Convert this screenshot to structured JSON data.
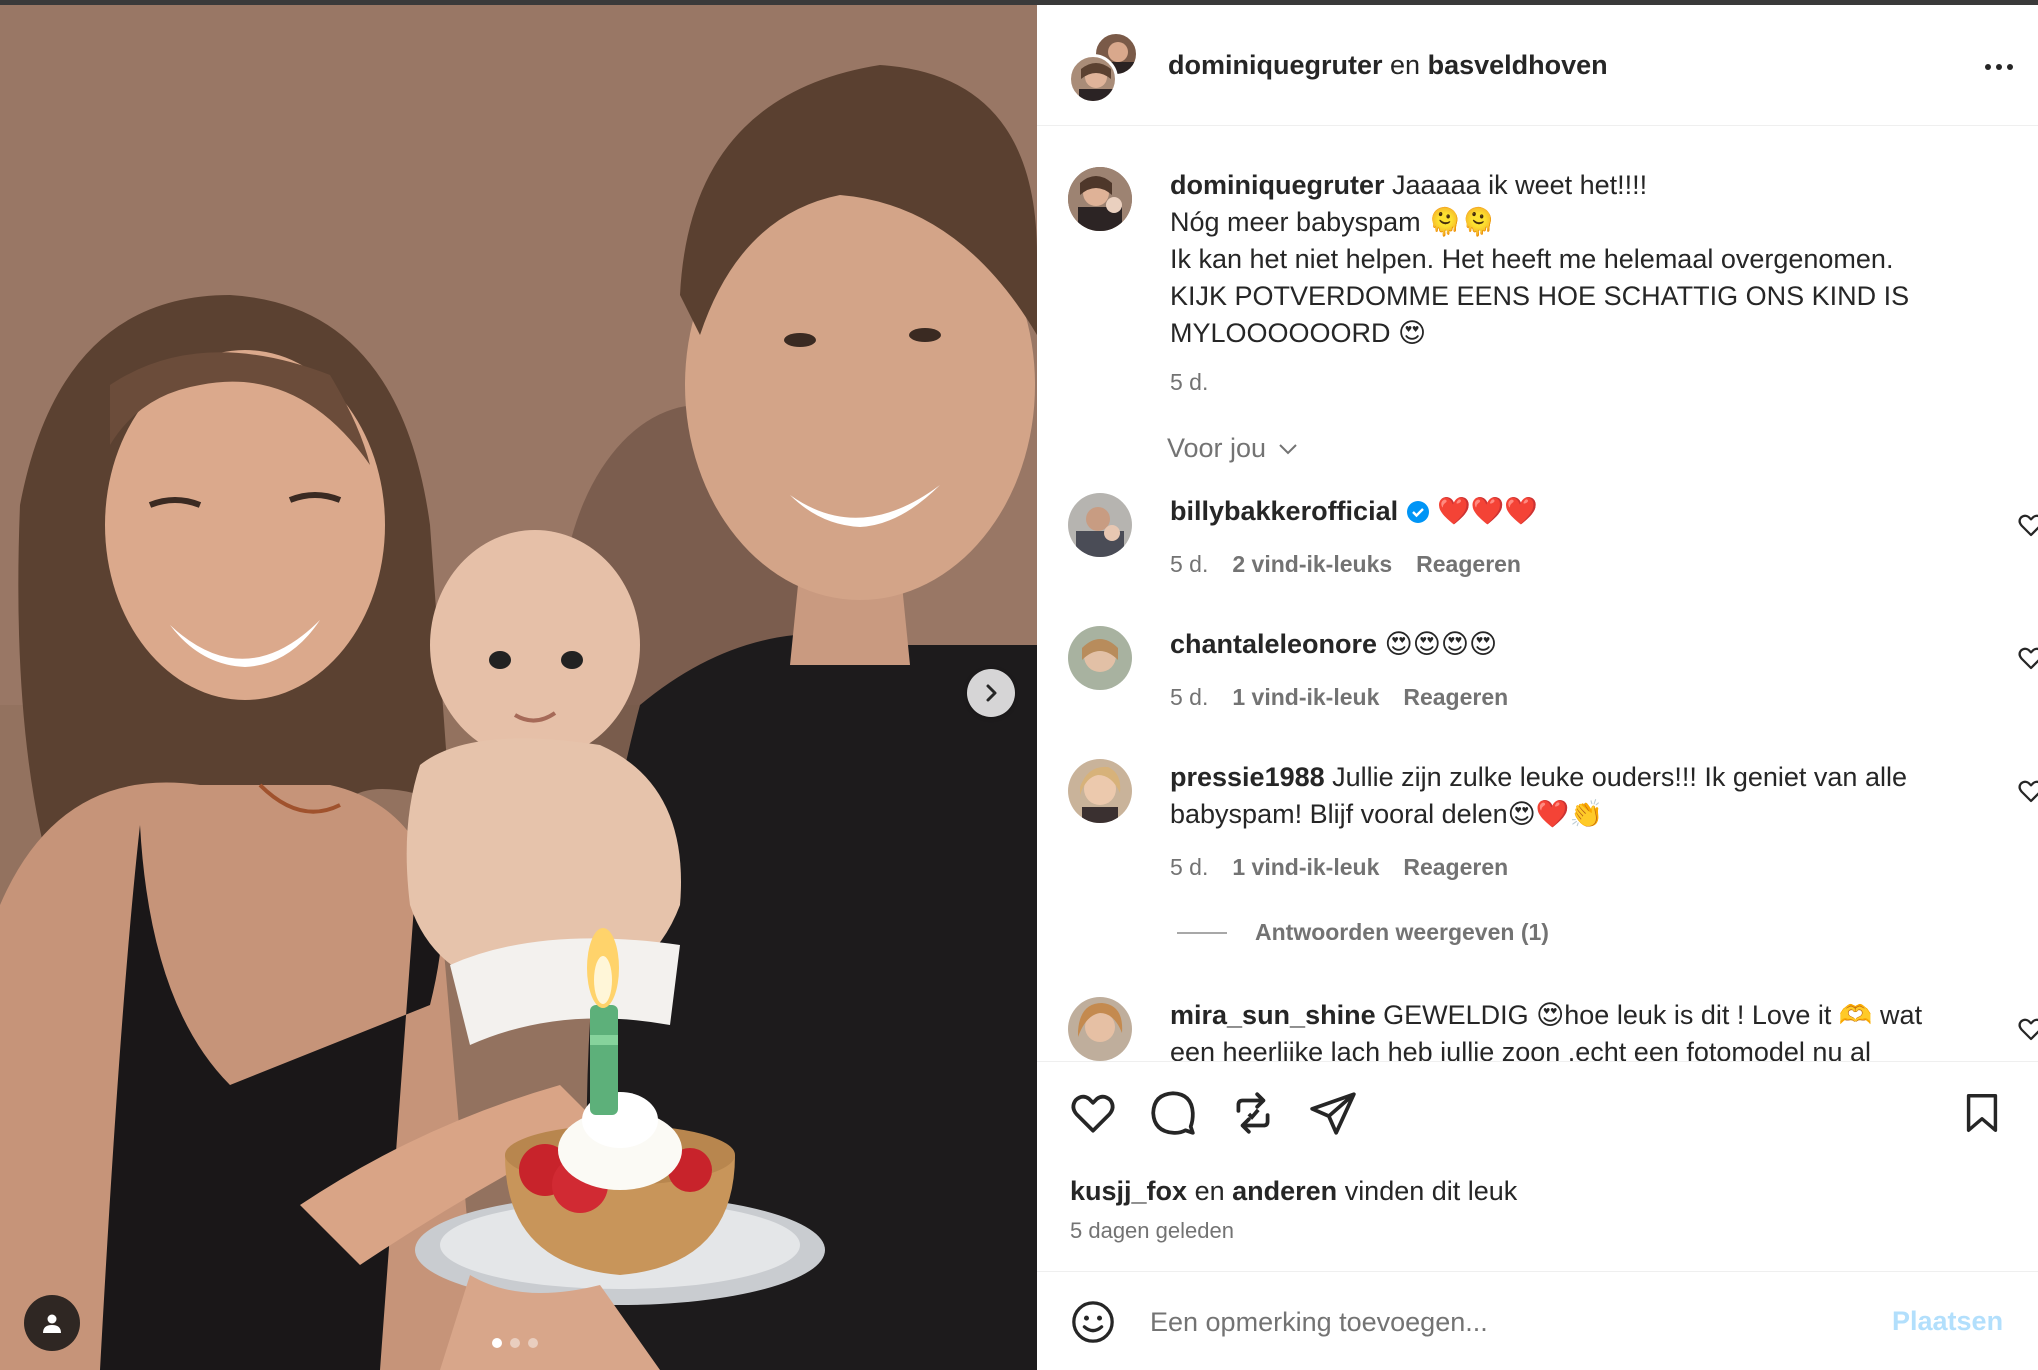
{
  "post": {
    "photo_dots": 3,
    "active_dot": 0
  },
  "header": {
    "author1": "dominiquegruter",
    "conjunction": "en",
    "author2": "basveldhoven"
  },
  "caption": {
    "user": "dominiquegruter",
    "line1": "Jaaaaa ik weet het!!!!",
    "line2": "Nóg meer babyspam 🫠🫠",
    "line3": "Ik kan het niet helpen. Het heeft me helemaal overgenomen.",
    "line4": "KIJK POTVERDOMME EENS HOE SCHATTIG ONS KIND IS",
    "line5": "MYLOOOOOORD 😍",
    "time": "5 d."
  },
  "sort_label": "Voor jou",
  "comments": [
    {
      "user": "billybakkerofficial",
      "verified": true,
      "text": "❤️❤️❤️",
      "time": "5 d.",
      "likes": "2 vind-ik-leuks",
      "reply": "Reageren"
    },
    {
      "user": "chantaleleonore",
      "text": "😍😍😍😍",
      "time": "5 d.",
      "likes": "1 vind-ik-leuk",
      "reply": "Reageren"
    },
    {
      "user": "pressie1988",
      "text": "Jullie zijn zulke leuke ouders!!! Ik geniet van alle babyspam! Blijf vooral delen😍❤️👏",
      "time": "5 d.",
      "likes": "1 vind-ik-leuk",
      "reply": "Reageren"
    },
    {
      "user": "mira_sun_shine",
      "text": "GEWELDIG 😍hoe leuk is dit ! Love it 🫶 wat een heerlijke lach heb jullie zoon .echt een fotomodel nu al"
    }
  ],
  "view_replies": "Antwoorden weergeven (1)",
  "likes_line": {
    "user": "kusjj_fox",
    "and": "en",
    "others": "anderen",
    "suffix": "vinden dit leuk"
  },
  "posted_ago": "5 dagen geleden",
  "composer": {
    "placeholder": "Een opmerking toevoegen...",
    "post_label": "Plaatsen"
  },
  "icons": {
    "like": "heart-icon",
    "comment": "comment-bubble-icon",
    "repost": "repost-icon",
    "share": "paper-plane-icon",
    "save": "bookmark-icon",
    "emoji": "emoji-smiley-icon",
    "next": "chevron-right-icon",
    "user_tag": "person-icon",
    "more": "more-horizontal-icon",
    "verified": "verified-badge-icon"
  },
  "colors": {
    "verified_blue": "#0095f6",
    "post_button_disabled": "#b2dffc",
    "secondary_text": "#737373"
  }
}
